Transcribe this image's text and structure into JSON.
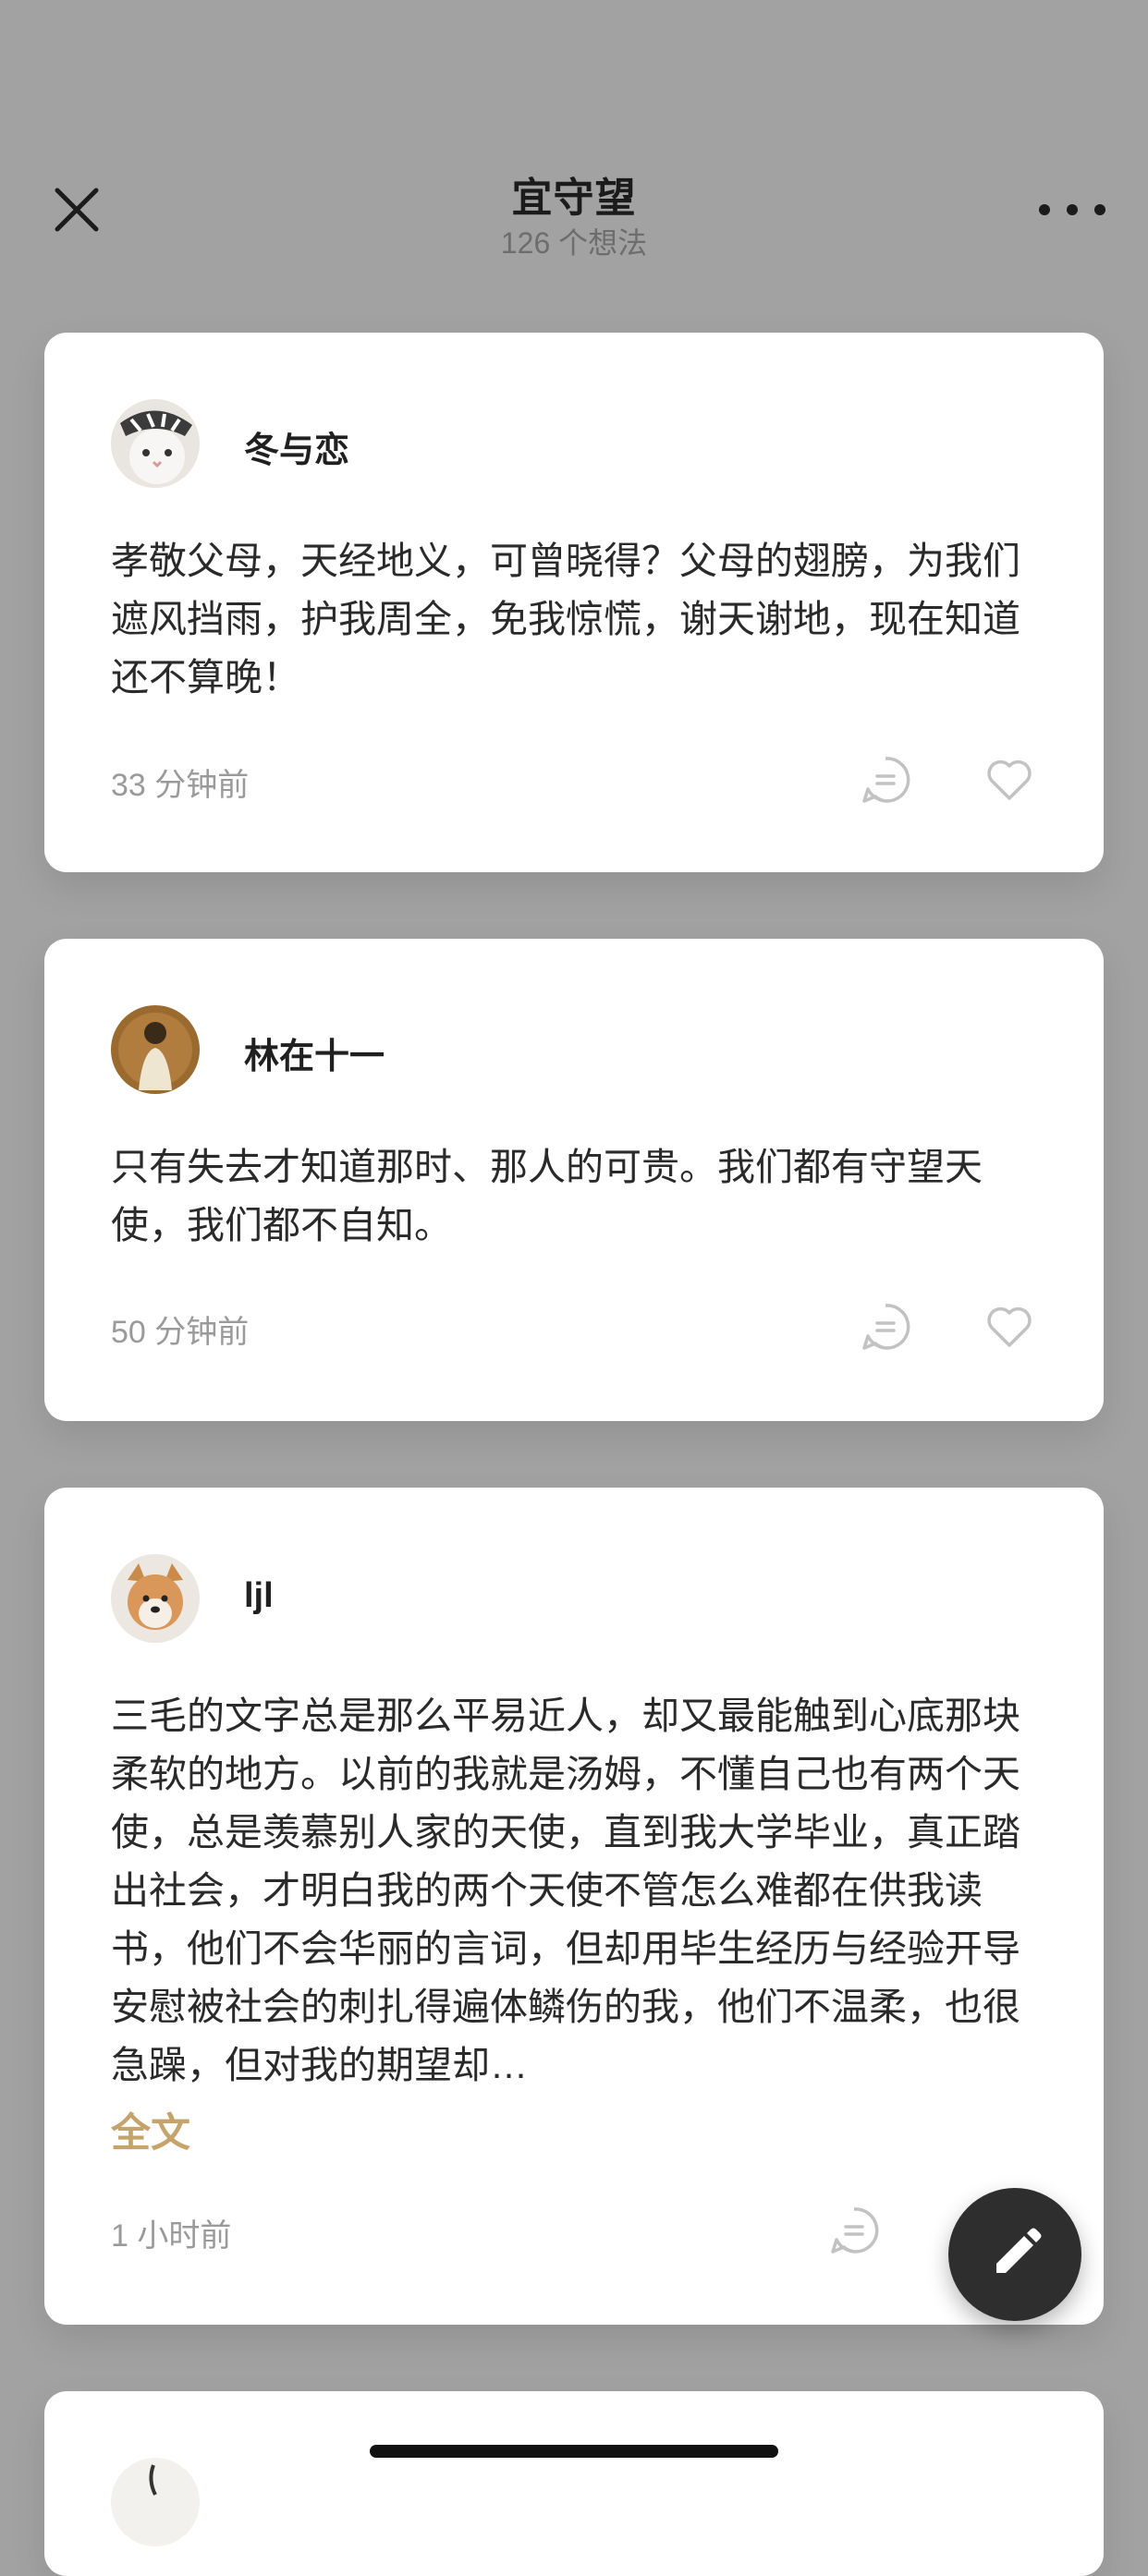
{
  "header": {
    "title": "宜守望",
    "subtitle": "126 个想法",
    "close_icon": "close-icon",
    "more_icon": "more-horizontal-icon"
  },
  "posts": [
    {
      "username": "冬与恋",
      "avatar": "white-cat-with-hat",
      "content": "孝敬父母，天经地义，可曾晓得？父母的翅膀，为我们遮风挡雨，护我周全，免我惊慌，谢天谢地，现在知道还不算晚！",
      "time": "33 分钟前"
    },
    {
      "username": "林在十一",
      "avatar": "person-photo",
      "content": "只有失去才知道那时、那人的可贵。我们都有守望天使，我们都不自知。",
      "time": "50 分钟前"
    },
    {
      "username": "ljl",
      "avatar": "shiba-dog",
      "content": "三毛的文字总是那么平易近人，却又最能触到心底那块柔软的地方。以前的我就是汤姆，不懂自己也有两个天使，总是羡慕别人家的天使，直到我大学毕业，真正踏出社会，才明白我的两个天使不管怎么难都在供我读书，他们不会华丽的言词，但却用毕生经历与经验开导安慰被社会的刺扎得遍体鳞伤的我，他们不温柔，也很急躁，但对我的期望却…",
      "full_text_label": "全文",
      "time": "1 小时前"
    }
  ],
  "icons": {
    "comment": "comment-icon",
    "like": "heart-icon",
    "compose": "pencil-icon"
  },
  "colors": {
    "overlay": "#a2a2a2",
    "accent": "#c5a46b",
    "fab": "#2e2e2e",
    "muted": "#9a9a9a"
  }
}
